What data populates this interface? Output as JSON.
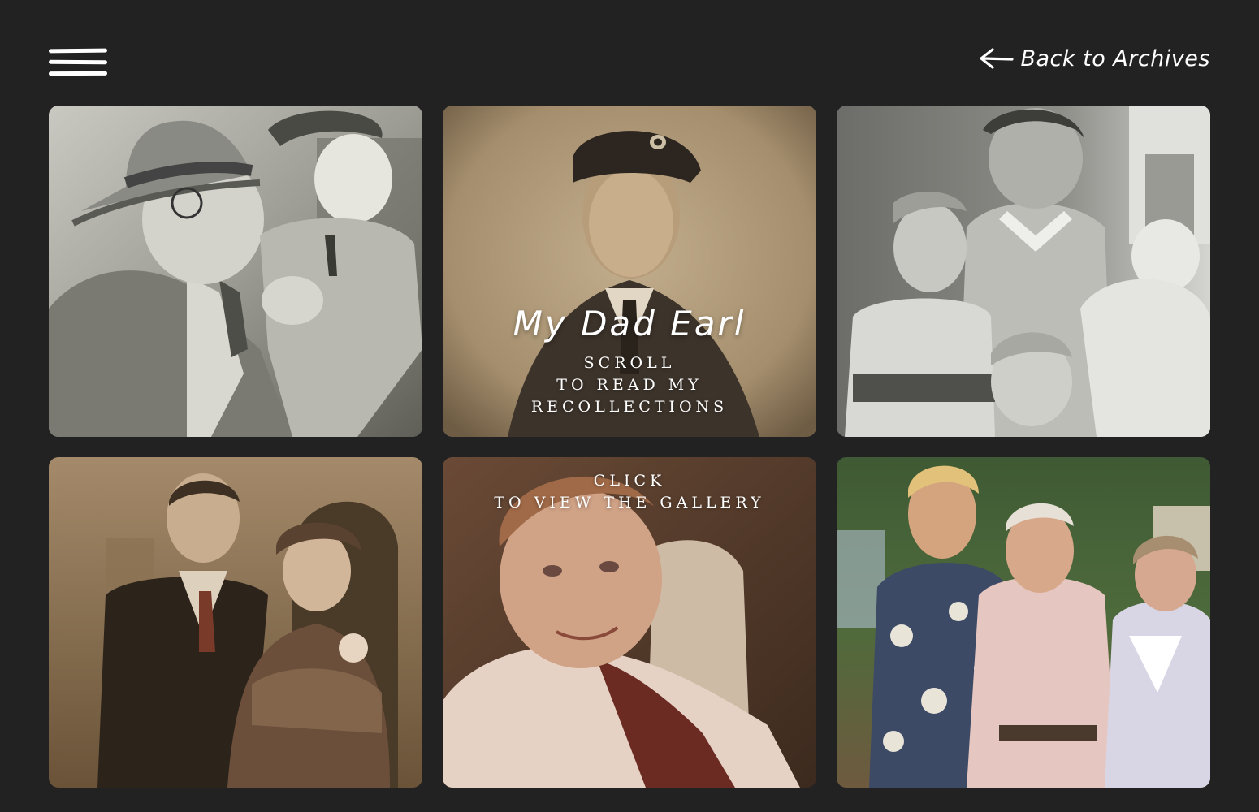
{
  "header": {
    "menu_icon": "hamburger-menu-icon",
    "back_label": "Back to Archives",
    "back_icon": "arrow-left-icon"
  },
  "tiles": [
    {
      "id": "tile-1",
      "description_tone": "black-and-white"
    },
    {
      "id": "tile-2",
      "title": "My Dad Earl",
      "caption_lines": [
        "Scroll",
        "to read my",
        "recollections"
      ],
      "description_tone": "sepia"
    },
    {
      "id": "tile-3",
      "description_tone": "black-and-white"
    },
    {
      "id": "tile-4",
      "description_tone": "sepia"
    },
    {
      "id": "tile-5",
      "caption_lines": [
        "Click",
        "to view the gallery"
      ],
      "description_tone": "color"
    },
    {
      "id": "tile-6",
      "description_tone": "color"
    }
  ],
  "colors": {
    "background": "#222222",
    "text": "#ffffff"
  }
}
